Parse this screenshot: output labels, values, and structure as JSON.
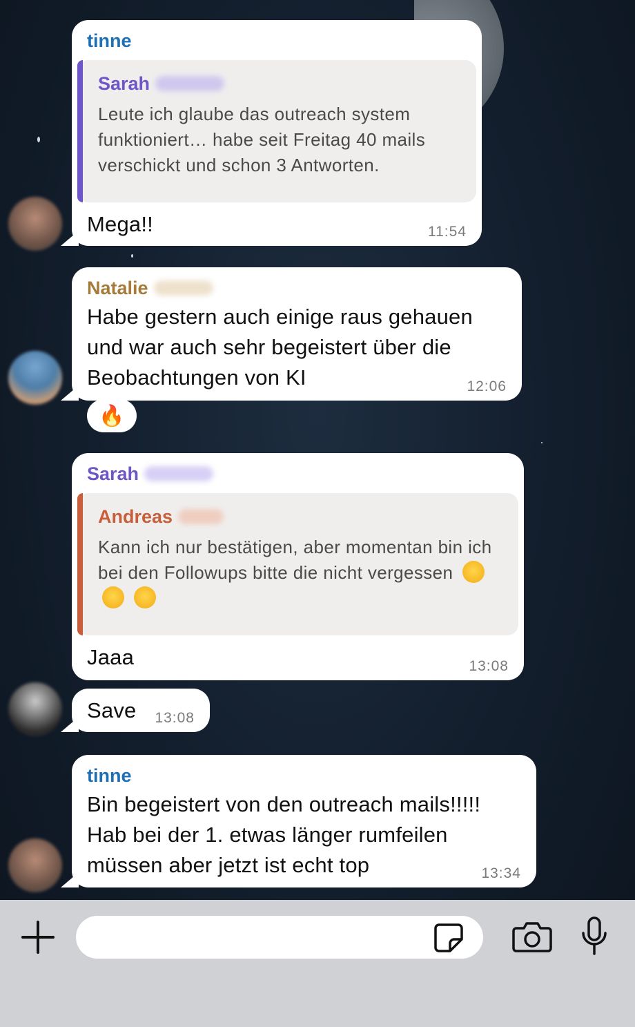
{
  "colors": {
    "tinne": "#1f6fb4",
    "sarah": "#6e56c9",
    "natalie": "#a57b3a",
    "andreas": "#c85e3a",
    "reaction": "#e8551f"
  },
  "messages": [
    {
      "sender": "tinne",
      "quote": {
        "name": "Sarah",
        "text": "Leute ich glaube das outreach system funktioniert… habe seit Freitag 40 mails verschickt und schon 3 Antworten."
      },
      "text": "Mega!!",
      "time": "11:54"
    },
    {
      "sender": "Natalie",
      "text": "Habe gestern auch einige raus gehauen und war auch sehr begeistert über die Beobachtungen von KI",
      "time": "12:06",
      "reaction": "🔥"
    },
    {
      "sender": "Sarah",
      "quote": {
        "name": "Andreas",
        "text": "Kann ich nur bestätigen, aber momentan bin ich bei den Followups  bitte die nicht vergessen"
      },
      "text": "Jaaa",
      "time": "13:08"
    },
    {
      "text": "Save",
      "time": "13:08"
    },
    {
      "sender": "tinne",
      "text": "Bin begeistert von den outreach mails!!!!! Hab bei der 1. etwas länger rumfeilen müssen aber jetzt ist echt top",
      "time": "13:34"
    }
  ],
  "input_bar": {
    "icons": [
      "plus-icon",
      "sticker-icon",
      "camera-icon",
      "microphone-icon"
    ]
  }
}
